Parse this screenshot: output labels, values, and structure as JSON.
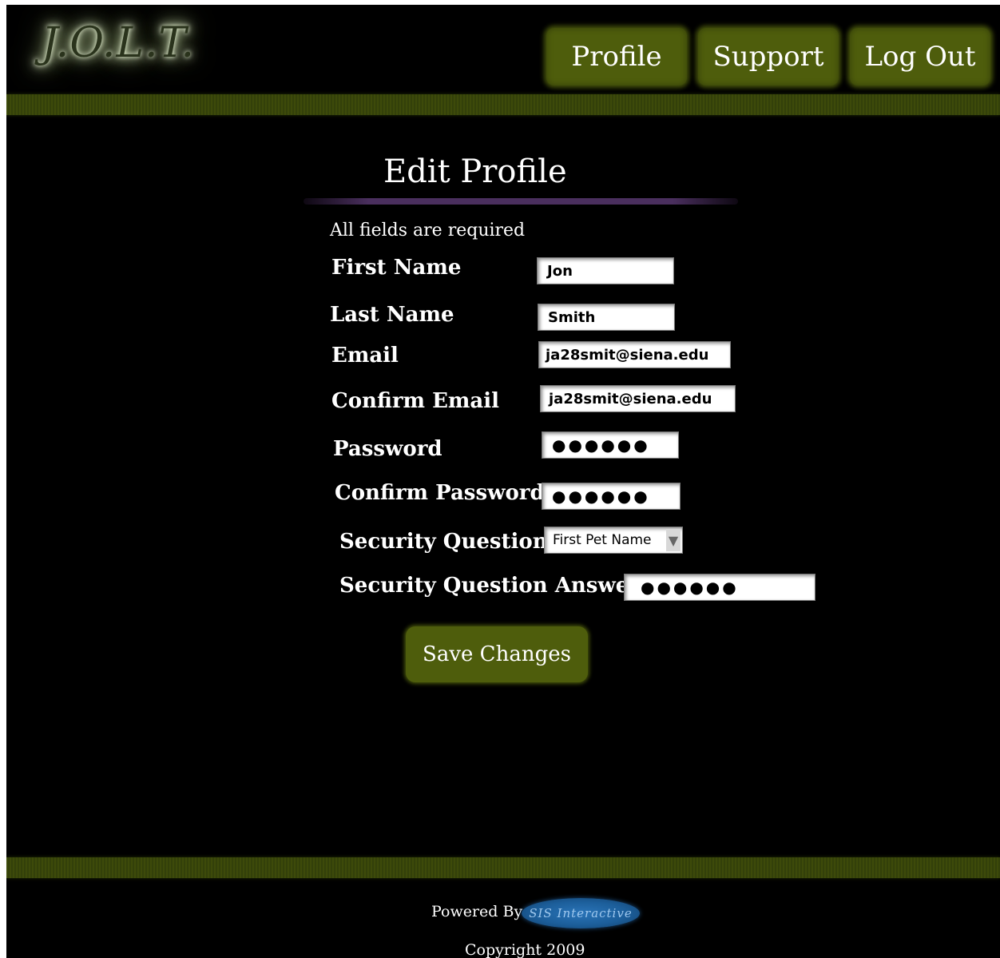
{
  "header": {
    "logo_text": "J.O.L.T.",
    "nav": {
      "profile_label": "Profile",
      "support_label": "Support",
      "logout_label": "Log Out"
    }
  },
  "main": {
    "title": "Edit Profile",
    "note": "All fields are required",
    "fields": {
      "first_name": {
        "label": "First Name",
        "value": "Jon"
      },
      "last_name": {
        "label": "Last Name",
        "value": "Smith"
      },
      "email": {
        "label": "Email",
        "value": "ja28smit@siena.edu"
      },
      "confirm_email": {
        "label": "Confirm Email",
        "value": "ja28smit@siena.edu"
      },
      "password": {
        "label": "Password",
        "value": "●●●●●●"
      },
      "confirm_password": {
        "label": "Confirm Password",
        "value": "●●●●●●"
      },
      "security_question": {
        "label": "Security Question",
        "value": "First Pet Name"
      },
      "security_answer": {
        "label": "Security Question Answer",
        "value": "●●●●●●"
      }
    },
    "save_label": "Save Changes"
  },
  "footer": {
    "powered_by": "Powered By",
    "powered_logo_text": "SIS Interactive",
    "copyright": "Copyright 2009"
  },
  "colors": {
    "background": "#000000",
    "button": "#4e5d0c",
    "band": "#3d4a0a",
    "title_underline": "#4a2f5e"
  },
  "icons": {
    "select_arrow": "arrow-down-icon"
  }
}
